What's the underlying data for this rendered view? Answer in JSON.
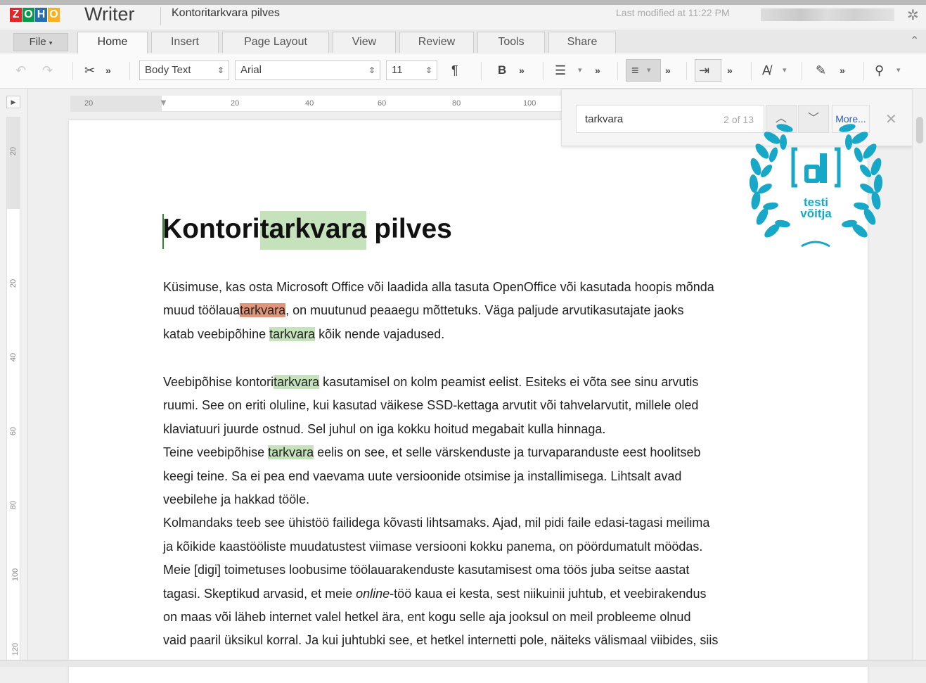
{
  "app": {
    "logo_letters": [
      "Z",
      "O",
      "H",
      "O"
    ],
    "logo_colors": [
      "#e42527",
      "#089949",
      "#226db4",
      "#f9b21d"
    ],
    "brand": "Writer",
    "doc_title": "Kontoritarkvara pilves",
    "last_modified": "Last modified at 11:22 PM"
  },
  "tabs": {
    "file": "File",
    "items": [
      "Home",
      "Insert",
      "Page Layout",
      "View",
      "Review",
      "Tools",
      "Share"
    ],
    "active": "Home"
  },
  "toolbar": {
    "style_value": "Body Text",
    "font_value": "Arial",
    "size_value": "11"
  },
  "ruler": {
    "h_ticks": [
      "20",
      "20",
      "40",
      "60",
      "80",
      "100"
    ],
    "v_ticks": [
      "20",
      "20",
      "40",
      "60",
      "80",
      "100",
      "120"
    ]
  },
  "find": {
    "query": "tarkvara",
    "count": "2 of 13",
    "more_label": "More..."
  },
  "badge": {
    "line1": "testi",
    "line2": "võitja",
    "color": "#18a8c7"
  },
  "document": {
    "heading_pre": "Kontori",
    "heading_hl": "tarkvara",
    "heading_post": " pilves",
    "p1_l1": "Küsimuse, kas osta Microsoft Office või laadida alla tasuta OpenOffice või kasutada hoopis mõnda",
    "p1_l2_pre": "muud töölaua",
    "p1_l2_hl": "tarkvara",
    "p1_l2_post": ", on muutunud peaaegu mõttetuks. Väga paljude arvutikasutajate jaoks",
    "p1_l3_pre": "katab veebipõhine ",
    "p1_l3_hl": "tarkvara",
    "p1_l3_post": " kõik nende vajadused.",
    "p2_l1_pre": "Veebipõhise kontori",
    "p2_l1_hl": "tarkvara",
    "p2_l1_post": " kasutamisel on kolm peamist eelist. Esiteks ei võta see sinu arvutis",
    "p2_l2": "ruumi. See on eriti oluline, kui kasutad väikese SSD-kettaga arvutit või tahvelarvutit, millele oled",
    "p2_l3": "klaviatuuri juurde ostnud. Sel juhul on iga kokku hoitud megabait kulla hinnaga.",
    "p3_l1_pre": "Teine veebipõhise ",
    "p3_l1_hl": "tarkvara",
    "p3_l1_post": " eelis on see, et selle värskenduste ja turvaparanduste eest hoolitseb",
    "p3_l2": "keegi teine. Sa ei pea end vaevama uute versioonide otsimise ja installimisega. Lihtsalt avad",
    "p3_l3": "veebilehe ja hakkad tööle.",
    "p4_l1": "Kolmandaks teeb see ühistöö failidega kõvasti lihtsamaks. Ajad, mil pidi faile edasi-tagasi meilima",
    "p4_l2": "ja kõikide kaastööliste muudatustest viimase versiooni kokku panema, on pöördumatult möödas.",
    "p4_l3": "Meie [digi] toimetuses loobusime töölauarakenduste kasutamisest oma töös juba seitse aastat",
    "p4_l4_pre": "tagasi. Skeptikud arvasid, et meie ",
    "p4_l4_em": "online",
    "p4_l4_post": "-töö kaua ei kesta, sest niikuinii juhtub, et veebirakendus",
    "p4_l5": "on maas või läheb internet valel hetkel ära, ent kogu selle aja jooksul on meil probleeme olnud",
    "p4_l6": "vaid paaril üksikul korral. Ja kui juhtubki see, et hetkel internetti pole, näiteks välismaal viibides, siis"
  }
}
